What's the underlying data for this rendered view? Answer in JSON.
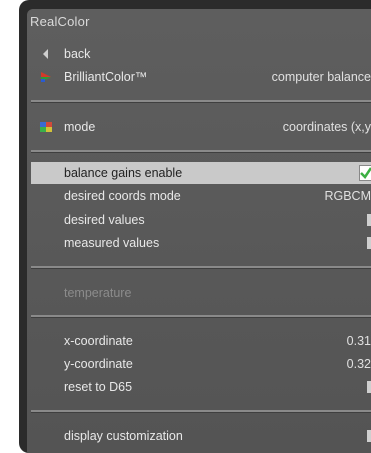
{
  "window": {
    "title": "RealColor"
  },
  "menu": {
    "back": {
      "label": "back",
      "icon": "back-arrow-icon"
    },
    "brilliant": {
      "label": "BrilliantColor™",
      "value": "computer balance",
      "icon": "brilliantcolor-icon"
    },
    "mode": {
      "label": "mode",
      "value": "coordinates (x,y",
      "icon": "color-grid-icon"
    },
    "balance_gains": {
      "label": "balance gains enable",
      "checked": true
    },
    "desired_coords_mode": {
      "label": "desired coords mode",
      "value": "RGBCM"
    },
    "desired_values": {
      "label": "desired values"
    },
    "measured_values": {
      "label": "measured values"
    },
    "temperature": {
      "label": "temperature"
    },
    "x_coordinate": {
      "label": "x-coordinate",
      "value": "0.31"
    },
    "y_coordinate": {
      "label": "y-coordinate",
      "value": "0.32"
    },
    "reset": {
      "label": "reset to D65"
    },
    "display_customization": {
      "label": "display customization"
    }
  },
  "colors": {
    "panel": "#5a5a5a",
    "frame": "#2b2b2b",
    "highlight": "#c9c9c9",
    "check": "#3cb043"
  }
}
